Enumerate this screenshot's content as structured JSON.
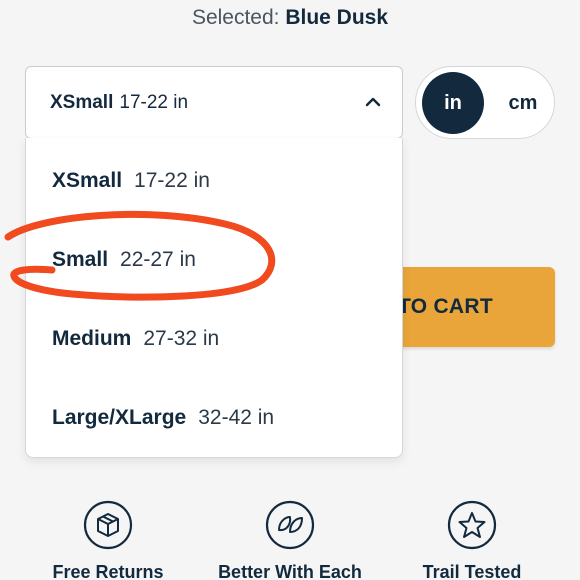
{
  "header": {
    "selected_label": "Selected:",
    "selected_value": "Blue Dusk"
  },
  "size_select": {
    "current_size": "XSmall",
    "current_range": "17-22 in",
    "expanded": true
  },
  "unit_toggle": {
    "options": [
      "in",
      "cm"
    ],
    "active": "in"
  },
  "dropdown": {
    "options": [
      {
        "size": "XSmall",
        "range": "17-22 in"
      },
      {
        "size": "Small",
        "range": "22-27 in",
        "annotated": true
      },
      {
        "size": "Medium",
        "range": "27-32 in"
      },
      {
        "size": "Large/XLarge",
        "range": "32-42 in"
      }
    ]
  },
  "cart_button": {
    "label_visible": "TO CART"
  },
  "features": [
    {
      "label": "Free Returns",
      "icon": "box-icon"
    },
    {
      "label": "Better With Each",
      "icon": "leaf-icon"
    },
    {
      "label": "Trail Tested",
      "icon": "star-icon"
    }
  ],
  "colors": {
    "navy": "#13293d",
    "accent_orange": "#e9a53a",
    "annotation_red": "#f04a1e",
    "background": "#f5f5f5"
  }
}
